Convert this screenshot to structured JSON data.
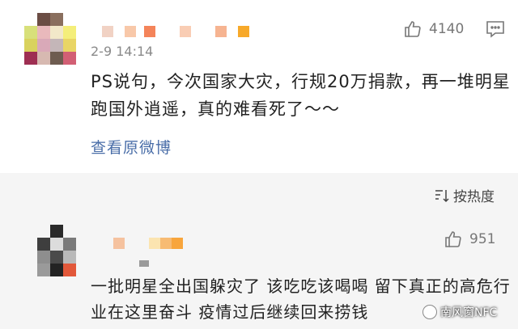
{
  "comment1": {
    "time": "2-9 14:14",
    "likes": "4140",
    "text": "PS说句，今次国家大灾，行规20万捐款，再一堆明星跑国外逍遥，真的难看死了～～",
    "view_original": "查看原微博"
  },
  "sort": {
    "label": "按热度"
  },
  "comment2": {
    "likes": "951",
    "text": "一批明星全出国躲灾了 该吃吃该喝喝 留下真正的高危行业在这里奋斗 疫情过后继续回来捞钱"
  },
  "watermark": {
    "text": "南风窗NFC"
  },
  "colors": {
    "link": "#4a6ea8",
    "meta": "#8a8a8a",
    "text": "#222222",
    "bg_gray": "#f5f5f5"
  },
  "icons": [
    "thumbs-up-icon",
    "chat-icon",
    "sort-icon",
    "watermark-logo-icon"
  ]
}
